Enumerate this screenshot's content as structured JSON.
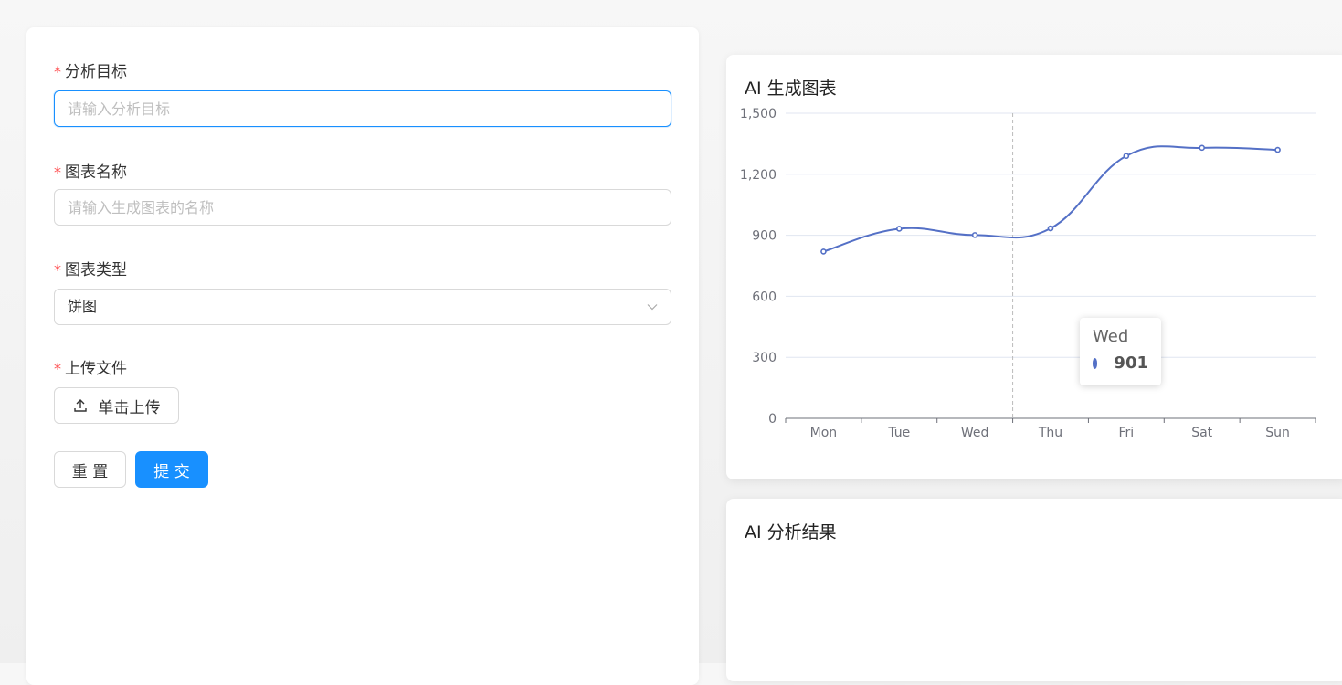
{
  "form": {
    "fields": [
      {
        "label": "分析目标",
        "placeholder": "请输入分析目标",
        "value": ""
      },
      {
        "label": "图表名称",
        "placeholder": "请输入生成图表的名称",
        "value": ""
      },
      {
        "label": "图表类型",
        "selected": "饼图"
      },
      {
        "label": "上传文件",
        "button": "单击上传"
      }
    ],
    "required_mark": "*",
    "reset_label": "重 置",
    "submit_label": "提 交"
  },
  "chart_card": {
    "title": "AI 生成图表"
  },
  "result_card": {
    "title": "AI 分析结果"
  },
  "colors": {
    "primary": "#1890ff",
    "required": "#ff4d4f",
    "series": "#5470c6"
  },
  "chart_data": {
    "type": "line",
    "smooth": true,
    "categories": [
      "Mon",
      "Tue",
      "Wed",
      "Thu",
      "Fri",
      "Sat",
      "Sun"
    ],
    "values": [
      820,
      932,
      901,
      934,
      1290,
      1330,
      1320
    ],
    "yticks": [
      "0",
      "300",
      "600",
      "900",
      "1,200",
      "1,500"
    ],
    "ylim": [
      0,
      1500
    ],
    "grid": true,
    "tooltip": {
      "category": "Wed",
      "value": "901"
    }
  }
}
